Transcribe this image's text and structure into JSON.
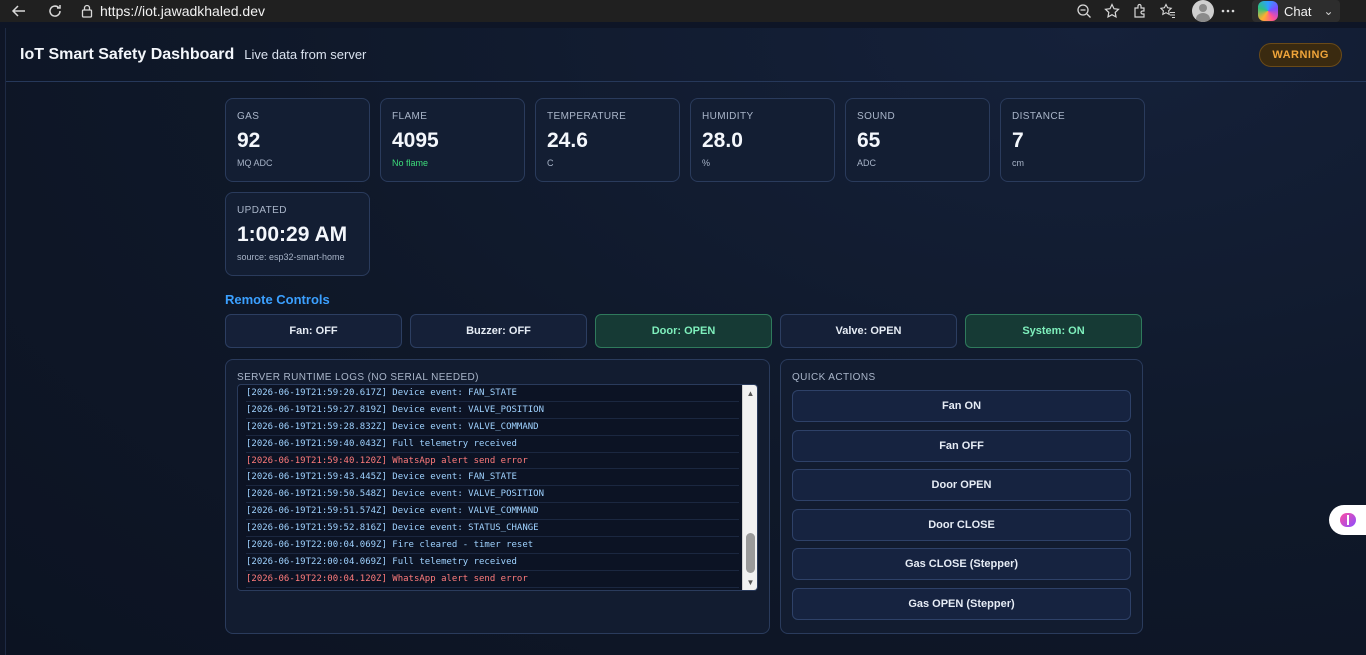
{
  "browser": {
    "url": "https://iot.jawadkhaled.dev",
    "chat_label": "Chat"
  },
  "header": {
    "title": "IoT Smart Safety Dashboard",
    "subtitle": "Live data from server",
    "status": "WARNING"
  },
  "metrics": [
    {
      "label": "GAS",
      "value": "92",
      "unit": "MQ ADC"
    },
    {
      "label": "FLAME",
      "value": "4095",
      "unit": "No flame"
    },
    {
      "label": "TEMPERATURE",
      "value": "24.6",
      "unit": "C"
    },
    {
      "label": "HUMIDITY",
      "value": "28.0",
      "unit": "%"
    },
    {
      "label": "SOUND",
      "value": "65",
      "unit": "ADC"
    },
    {
      "label": "DISTANCE",
      "value": "7",
      "unit": "cm"
    },
    {
      "label": "UPDATED",
      "value": "1:00:29 AM",
      "unit": "source: esp32-smart-home"
    }
  ],
  "remote_controls": {
    "title": "Remote Controls",
    "items": [
      {
        "label": "Fan: OFF"
      },
      {
        "label": "Buzzer: OFF"
      },
      {
        "label": "Door: OPEN"
      },
      {
        "label": "Valve: OPEN"
      },
      {
        "label": "System: ON"
      }
    ]
  },
  "logs": {
    "title": "SERVER RUNTIME LOGS (NO SERIAL NEEDED)",
    "lines": [
      "[2026-06-19T21:59:20.617Z] Device event: FAN_STATE",
      "[2026-06-19T21:59:27.819Z] Device event: VALVE_POSITION",
      "[2026-06-19T21:59:28.832Z] Device event: VALVE_COMMAND",
      "[2026-06-19T21:59:40.043Z] Full telemetry received",
      "[2026-06-19T21:59:40.120Z] WhatsApp alert send error",
      "[2026-06-19T21:59:43.445Z] Device event: FAN_STATE",
      "[2026-06-19T21:59:50.548Z] Device event: VALVE_POSITION",
      "[2026-06-19T21:59:51.574Z] Device event: VALVE_COMMAND",
      "[2026-06-19T21:59:52.816Z] Device event: STATUS_CHANGE",
      "[2026-06-19T22:00:04.069Z] Fire cleared - timer reset",
      "[2026-06-19T22:00:04.069Z] Full telemetry received",
      "[2026-06-19T22:00:04.120Z] WhatsApp alert send error"
    ]
  },
  "quick_actions": {
    "title": "QUICK ACTIONS",
    "items": [
      {
        "label": "Fan ON"
      },
      {
        "label": "Fan OFF"
      },
      {
        "label": "Door OPEN"
      },
      {
        "label": "Door CLOSE"
      },
      {
        "label": "Gas CLOSE (Stepper)"
      },
      {
        "label": "Gas OPEN (Stepper)"
      }
    ]
  },
  "colors": {
    "accent": "#3ba0ff",
    "warning": "#f0a53a",
    "ok": "#3ddc7a",
    "error_log": "#ff7b7b"
  }
}
